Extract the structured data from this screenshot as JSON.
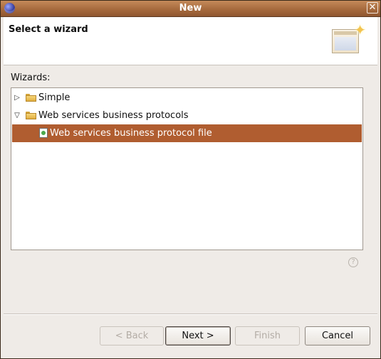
{
  "window": {
    "title": "New",
    "close_glyph": "✕"
  },
  "header": {
    "title": "Select a wizard",
    "banner_icon": "wizard-banner-icon"
  },
  "wizards": {
    "label": "Wizards:",
    "tree": [
      {
        "label": "Simple",
        "expanded": false,
        "icon": "folder-icon",
        "level": 0
      },
      {
        "label": "Web services business protocols",
        "expanded": true,
        "icon": "folder-open-icon",
        "level": 0
      },
      {
        "label": "Web services business protocol file",
        "icon": "file-icon",
        "level": 1,
        "selected": true
      }
    ]
  },
  "help": {
    "glyph": "?"
  },
  "buttons": {
    "back": "< Back",
    "next": "Next >",
    "finish": "Finish",
    "cancel": "Cancel"
  },
  "colors": {
    "titlebar": "#a66a3d",
    "selection": "#b05d30",
    "dialog_bg": "#efebe7"
  }
}
